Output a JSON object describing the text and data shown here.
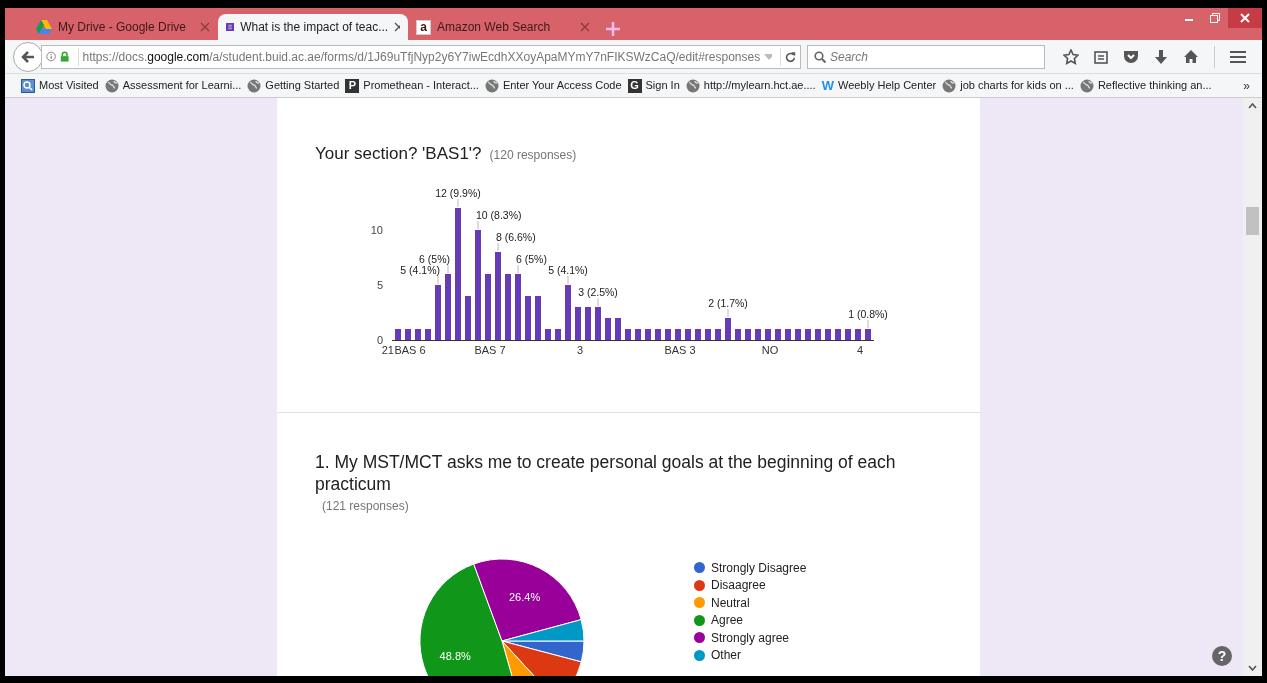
{
  "browser": {
    "tabs": [
      {
        "title": "My Drive - Google Drive",
        "selected": false,
        "kind": "drive"
      },
      {
        "title": "What is the impact of teac...",
        "selected": true,
        "kind": "forms"
      },
      {
        "title": "Amazon Web Search",
        "selected": false,
        "kind": "amazon",
        "icon_text": "a"
      }
    ],
    "url": {
      "prefix": "https://docs.",
      "domain": "google.com",
      "path": "/a/student.buid.ac.ae/forms/d/1J69uTfjNyp2y6Y7iwEcdhXXoyApaMYmY7nFIKSWzCaQ/edit#responses"
    },
    "search": {
      "placeholder": "Search"
    },
    "bookmarks": [
      {
        "label": "Most Visited",
        "kind": "folder"
      },
      {
        "label": "Assessment for Learni...",
        "kind": "globe"
      },
      {
        "label": "Getting Started",
        "kind": "globe"
      },
      {
        "label": "Promethean - Interact...",
        "kind": "letter",
        "icon_text": "P"
      },
      {
        "label": "Enter Your Access Code",
        "kind": "globe"
      },
      {
        "label": "Sign In",
        "kind": "letter",
        "icon_text": "G"
      },
      {
        "label": "http://mylearn.hct.ae....",
        "kind": "globe"
      },
      {
        "label": "Weebly Help Center",
        "kind": "weebly",
        "icon_text": "W"
      },
      {
        "label": "job charts for kids on ...",
        "kind": "globe"
      },
      {
        "label": "Reflective thinking an...",
        "kind": "globe"
      }
    ],
    "bookmarks_overflow": "»"
  },
  "questions": [
    {
      "title": "Your section? 'BAS1'?",
      "responses": "(120 responses)",
      "chart_data": {
        "type": "bar",
        "values": [
          1,
          1,
          1,
          1,
          5,
          6,
          12,
          4,
          10,
          6,
          8,
          6,
          6,
          4,
          4,
          1,
          1,
          5,
          3,
          3,
          3,
          2,
          2,
          1,
          1,
          1,
          1,
          1,
          1,
          1,
          1,
          1,
          1,
          2,
          1,
          1,
          1,
          1,
          1,
          1,
          1,
          1,
          1,
          1,
          1,
          1,
          1,
          1
        ],
        "categories": [
          "21",
          "BAS 6",
          null,
          null,
          null,
          null,
          null,
          null,
          null,
          "BAS 7",
          null,
          null,
          null,
          null,
          null,
          null,
          null,
          null,
          "3",
          null,
          null,
          null,
          null,
          null,
          null,
          null,
          null,
          null,
          "BAS 3",
          null,
          null,
          null,
          null,
          null,
          null,
          null,
          null,
          "NO",
          null,
          null,
          null,
          null,
          null,
          null,
          null,
          null,
          "4",
          null
        ],
        "ylim": [
          0,
          12
        ],
        "yticks": [
          0,
          5,
          10
        ],
        "value_labels": [
          null,
          null,
          null,
          null,
          "5 (4.1%)",
          "6 (5%)",
          "12 (9.9%)",
          null,
          "10 (8.3%)",
          null,
          "8 (6.6%)",
          null,
          "6 (5%)",
          null,
          null,
          null,
          null,
          "5 (4.1%)",
          null,
          null,
          "3 (2.5%)",
          null,
          null,
          null,
          null,
          null,
          null,
          null,
          null,
          null,
          null,
          null,
          null,
          "2 (1.7%)",
          null,
          null,
          null,
          null,
          null,
          null,
          null,
          null,
          null,
          null,
          null,
          null,
          null,
          "1 (0.8%)"
        ]
      }
    },
    {
      "title": "1. My MST/MCT asks me to create personal goals at the beginning of each practicum",
      "responses": "(121 responses)",
      "chart_data": {
        "type": "pie",
        "categories": [
          "Strongly Disagree",
          "Disaagree",
          "Neutral",
          "Agree",
          "Strongly agree",
          "Other"
        ],
        "values": [
          4.1,
          9.1,
          7.4,
          48.8,
          26.4,
          4.2
        ],
        "colors": [
          "#3366cc",
          "#dc3912",
          "#ff9900",
          "#109618",
          "#990099",
          "#0099c6"
        ],
        "value_labels": [
          null,
          null,
          null,
          "48.8%",
          "26.4%",
          null
        ]
      }
    }
  ],
  "help": "?"
}
